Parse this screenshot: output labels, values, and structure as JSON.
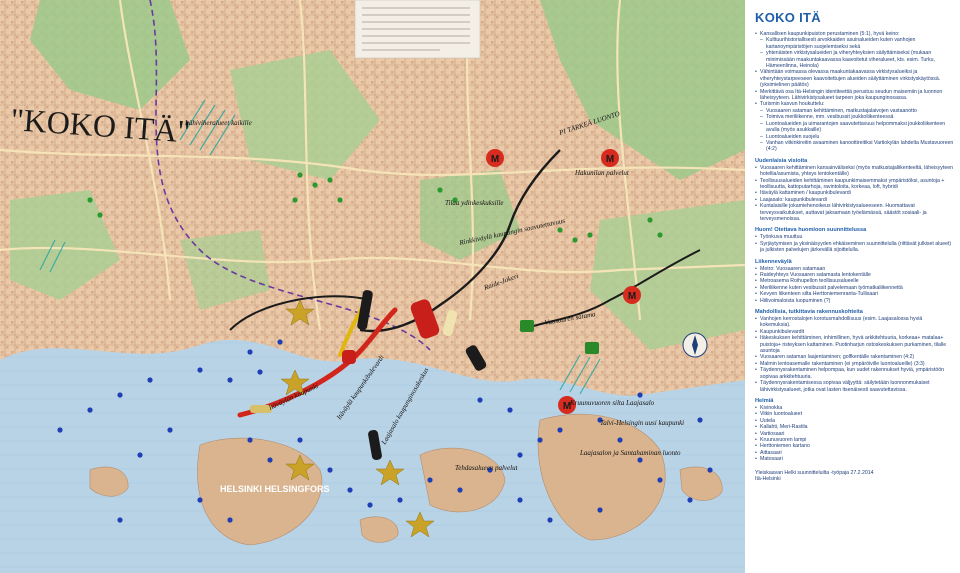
{
  "map": {
    "handwritten_title": "\"KOKO ITÄ\"",
    "city_label": "HELSINKI HELSINGFORS",
    "metro_symbol": "M",
    "annotations": [
      "Rinkkiväylä kaupungin saavutettavuus",
      "PI TÄRKEÄ LUONTO",
      "Hakunilan palvelut",
      "Tilaa ydinkeskuksille",
      "Itäväylän kaupunki",
      "Raide-Jokeri",
      "Vuosaaren satama",
      "Itäväylä kaupunkibulevardi",
      "Laajasalo kaupunginosakeskus",
      "Tehdasalueen palvelut",
      "Laajasalon ja Santahaminan luonto",
      "Kruunuvuoren silta Laajasalo",
      "Talvi-Helsingin uusi kaupunki",
      "Lähiviheralueet kaikille"
    ]
  },
  "panel": {
    "title": "KOKO ITÄ",
    "intro_items": [
      {
        "t": "Kansallisen kaupunkipuiston perustaminen (5:1), hyvä keino:",
        "sub": false
      },
      {
        "t": "Kulttuurihistoriallisesti arvokkaiden asuinalueiden kuten vanhojen kartanoympäristöjen suojelemiseksi sekä",
        "sub": true
      },
      {
        "t": "yhtenäisten virkistysalueiden ja viheryhteyksien säilyttämiseksi (mukaan minimissään maakuntakaavassa kaavoitetut viheralueet, kts. esim. Turku, Hämeenlinna, Heinola)",
        "sub": true
      },
      {
        "t": "Vähintään voimassa olevassa maakuntakaavassa virkistysalueiksi ja viheryhteystarpeeseen kaavoitettujen alueiden säilyttäminen virkistyskäytössä. (yksimielinen päätös)",
        "sub": false
      },
      {
        "t": "Merkittävä osa Itä-Helsingin identiteettiä perustuu seudun maisemiin ja luonnon läheisyyteen. Lähivirkistysalueet tarpeen joka kaupunginosassa.",
        "sub": false
      },
      {
        "t": "Turismin kasvun houkuttelu:",
        "sub": false
      },
      {
        "t": "Vuosaaren sataman kehittäminen, matkustajalaivojen vastaanotto",
        "sub": true
      },
      {
        "t": "Toimiva meriliikenne, mm. vesibussit joukkoliikenteessä",
        "sub": true
      },
      {
        "t": "Luontoalueiden ja uimarantojen saavutettavuus helpommaksi joukkoliikenteen avulla (myös asukkaille)",
        "sub": true
      },
      {
        "t": "Luontoalueiden suojelu",
        "sub": true
      },
      {
        "t": "Vanhan viikinkireitin avaaminen kanoottireitiksi Vartiokylän lahdelta Mustavuoreen (4:2)",
        "sub": true
      }
    ],
    "sections": [
      {
        "heading": "Uudenlaisia visioita",
        "items": [
          "Vuosaaren kehittäminen kansainväliseksi (myös matkustajaliikenteeltä, läheisyyteen hotellia/asumista, yhteys lentokentälle)",
          "Teollisuusalueiden kehittäminen kaupunkimaisemmaksi ympäristöksi, asuntoja + teollisuutta, kattoputarhoja, ravintoloita, korkeaa, loft, hybridi",
          "Itäväylä kattaminen / kaupunkibulevardi",
          "Laajasalo: kaupunkibulevardi",
          "Kuntalaisille jokamiehenoikeus lähivirkistysalueeseen. Huomattavat terveysvaikutukset, auttavat jaksamaan työelämässä, säästöt sosiaali- ja terveysmenoissa."
        ]
      },
      {
        "heading": "Huom! Otettava huomioon suunnittelussa",
        "items": [
          "Työnkuva muuttuu",
          "Syrjäytymisen ja yksinäisyyden ehkäiseminen suunnittelulla (riittävät julkiset alueet) ja julkisten palvelujen järkevällä sijoittelulla."
        ]
      },
      {
        "heading": "Liikenneväylä",
        "items": [
          "Metro: Vuosaaren satamaan",
          "Raideyhteys Vuosaaren satamasta lentokentälle",
          "Metroasema Roihupellon teollisuusalueelle",
          "Meriliikenne kuten vesibussit palvelemaan työmatkaliikennettä",
          "Kevyen liikenteen silta Herttoniemenranta-Tullisaari",
          "Hiilivoimaloista luopuminen (?)"
        ]
      },
      {
        "heading": "Mahdollisia, tutkittavia rakennuskohteita",
        "items": [
          "Vanhojen kerrostalojen korotusmahdollisuus (esim. Laajasalossa hyviä kokemuksia).",
          "Kaupunkibulevardit",
          "Itäkeskuksen kehittäminen, inhimillinen, hyvä arkkitehtuuria, korkeaa+ matalaa+ puistoja+ risteyksen kattaminen. Puotinharjun ostoskeskuksen purkaminen, tilalle asuntoja",
          "Vuosaaren sataman laajentaminen; golfkentälle rakentaminen (4:2)",
          "Malmin lentoasemalle rakentaminen (ei ympäröiville luontoalueille) (3:3)",
          "Täydennysrakentaminen helpompaa, kun uudet rakennukset hyviä, ympäristöön sopivaa arkkitehtuuria.",
          "Täydennysrakentamisessa sopivaa väljyyttä: säilytetään luonnonmukaiset lähivirkistysalueet, jotka ovat lasten itsenäisesti saavutettavissa."
        ]
      },
      {
        "heading": "Helmiä",
        "items": [
          "Kivinokka",
          "Viikin luontoalueet",
          "Uutela",
          "Kallahti, Meri-Rastila",
          "Vartiosaari",
          "Kruunuvuoren lampi",
          "Herttoniemen kartano",
          "Aittasaari",
          "Matosaari"
        ]
      }
    ],
    "footer_line1": "Yleiskaavan Helki suunnitteluilta -työpaja 27.2.2014",
    "footer_line2": "Itä-Helsinki"
  }
}
